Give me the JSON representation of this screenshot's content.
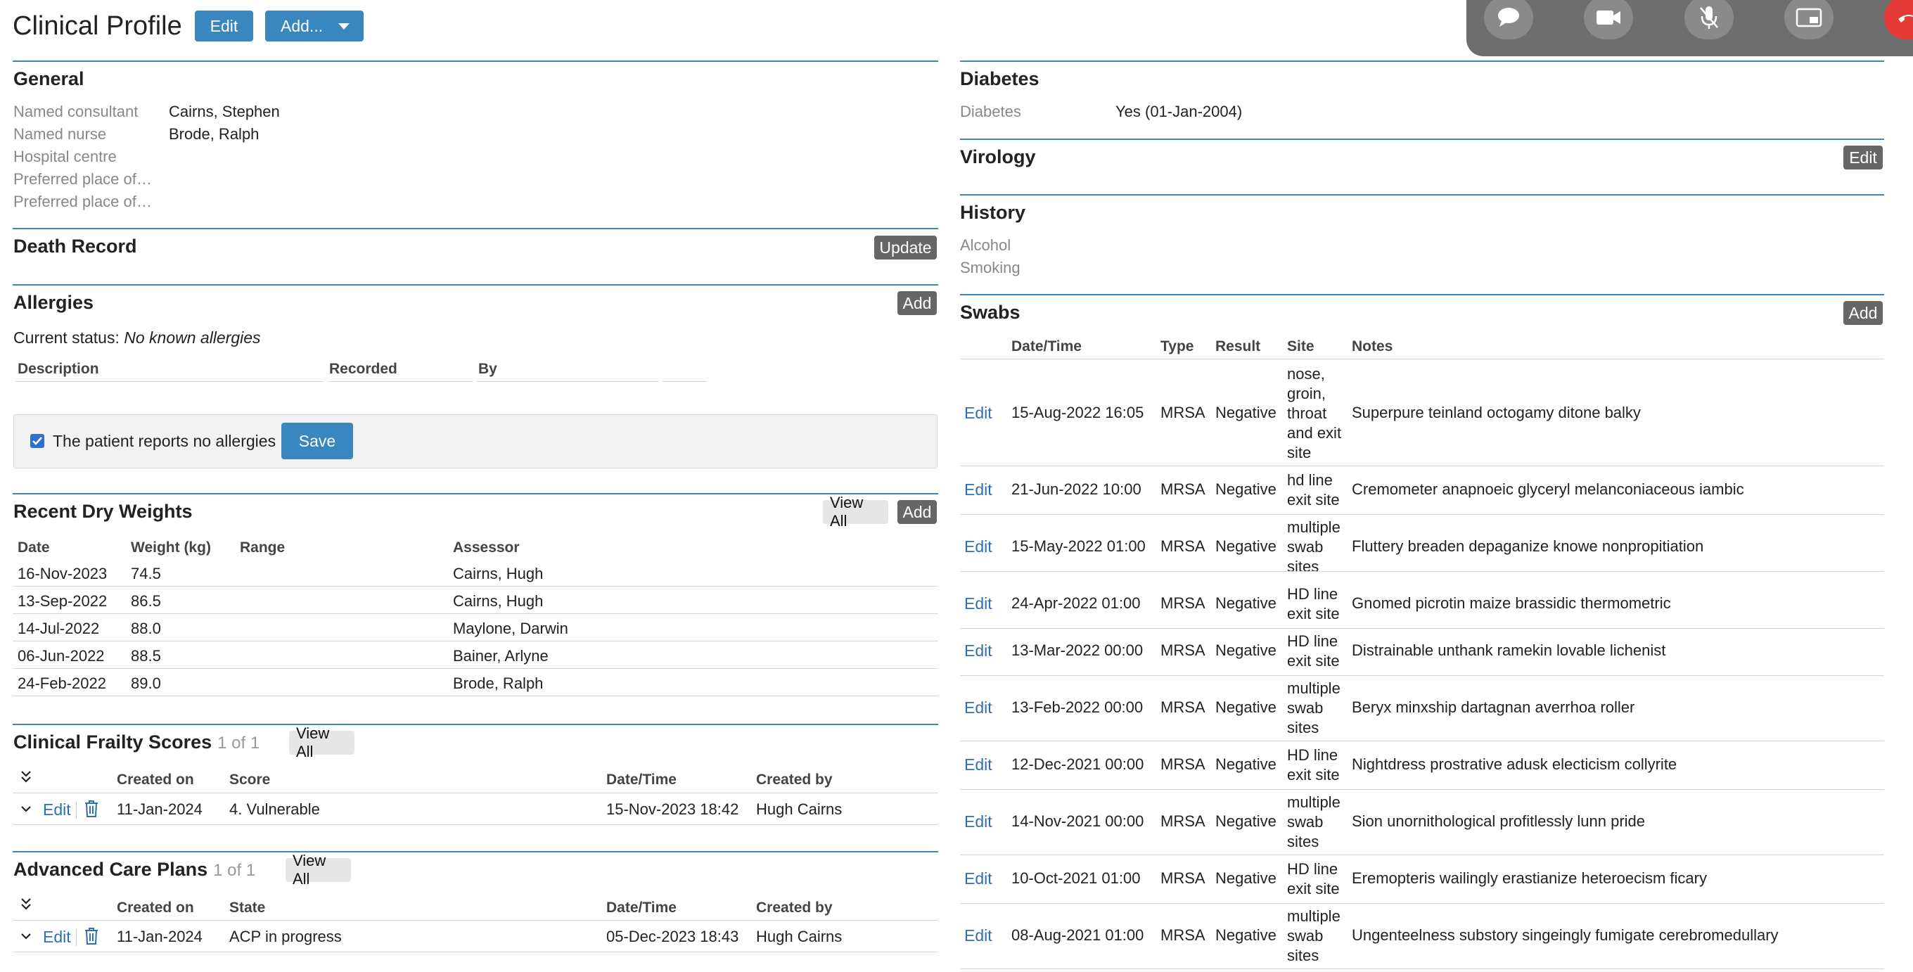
{
  "header": {
    "title": "Clinical Profile",
    "edit_label": "Edit",
    "add_label": "Add..."
  },
  "general": {
    "title": "General",
    "fields": [
      {
        "label": "Named consultant",
        "value": "Cairns, Stephen"
      },
      {
        "label": "Named nurse",
        "value": "Brode, Ralph"
      },
      {
        "label": "Hospital centre",
        "value": ""
      },
      {
        "label": "Preferred place of…",
        "value": ""
      },
      {
        "label": "Preferred place of…",
        "value": ""
      }
    ]
  },
  "death_record": {
    "title": "Death Record",
    "update_label": "Update"
  },
  "allergies": {
    "title": "Allergies",
    "add_label": "Add",
    "status_prefix": "Current status:",
    "status_value": "No known allergies",
    "columns": [
      "Description",
      "Recorded",
      "By"
    ],
    "checkbox_label": "The patient reports no allergies",
    "save_label": "Save"
  },
  "dry_weights": {
    "title": "Recent Dry Weights",
    "view_all_label": "View All",
    "add_label": "Add",
    "columns": [
      "Date",
      "Weight (kg)",
      "Range",
      "Assessor"
    ],
    "rows": [
      {
        "date": "16-Nov-2023",
        "weight": "74.5",
        "range": "",
        "assessor": "Cairns, Hugh"
      },
      {
        "date": "13-Sep-2022",
        "weight": "86.5",
        "range": "",
        "assessor": "Cairns, Hugh"
      },
      {
        "date": "14-Jul-2022",
        "weight": "88.0",
        "range": "",
        "assessor": "Maylone, Darwin"
      },
      {
        "date": "06-Jun-2022",
        "weight": "88.5",
        "range": "",
        "assessor": "Bainer, Arlyne"
      },
      {
        "date": "24-Feb-2022",
        "weight": "89.0",
        "range": "",
        "assessor": "Brode, Ralph"
      }
    ]
  },
  "frailty": {
    "title": "Clinical Frailty Scores",
    "count": "1 of 1",
    "view_all_label": "View All",
    "columns": [
      "Created on",
      "Score",
      "Date/Time",
      "Created by"
    ],
    "rows": [
      {
        "edit": "Edit",
        "created_on": "11-Jan-2024",
        "score": "4. Vulnerable",
        "datetime": "15-Nov-2023 18:42",
        "created_by": "Hugh Cairns"
      }
    ]
  },
  "acp": {
    "title": "Advanced Care Plans",
    "count": "1 of 1",
    "view_all_label": "View All",
    "columns": [
      "Created on",
      "State",
      "Date/Time",
      "Created by"
    ],
    "rows": [
      {
        "edit": "Edit",
        "created_on": "11-Jan-2024",
        "state": "ACP in progress",
        "datetime": "05-Dec-2023 18:43",
        "created_by": "Hugh Cairns"
      }
    ]
  },
  "diabetes": {
    "title": "Diabetes",
    "label": "Diabetes",
    "value": "Yes (01-Jan-2004)"
  },
  "virology": {
    "title": "Virology",
    "edit_label": "Edit"
  },
  "history": {
    "title": "History",
    "fields": [
      "Alcohol",
      "Smoking"
    ]
  },
  "swabs": {
    "title": "Swabs",
    "add_label": "Add",
    "columns": [
      "Date/Time",
      "Type",
      "Result",
      "Site",
      "Notes"
    ],
    "rows": [
      {
        "edit": "Edit",
        "datetime": "15-Aug-2022 16:05",
        "type": "MRSA",
        "result": "Negative",
        "site": "nose, groin, throat and exit site",
        "notes": "Superpure teinland octogamy ditone balky"
      },
      {
        "edit": "Edit",
        "datetime": "21-Jun-2022 10:00",
        "type": "MRSA",
        "result": "Negative",
        "site": "hd line exit site",
        "notes": "Cremometer anapnoeic glyceryl melanconiaceous iambic"
      },
      {
        "edit": "Edit",
        "datetime": "15-May-2022 01:00",
        "type": "MRSA",
        "result": "Negative",
        "site": "multiple swab sites",
        "notes": "Fluttery breaden depaganize knowe nonpropitiation"
      },
      {
        "edit": "Edit",
        "datetime": "24-Apr-2022 01:00",
        "type": "MRSA",
        "result": "Negative",
        "site": "HD line exit site",
        "notes": "Gnomed picrotin maize brassidic thermometric"
      },
      {
        "edit": "Edit",
        "datetime": "13-Mar-2022 00:00",
        "type": "MRSA",
        "result": "Negative",
        "site": "HD line exit site",
        "notes": "Distrainable unthank ramekin lovable lichenist"
      },
      {
        "edit": "Edit",
        "datetime": "13-Feb-2022 00:00",
        "type": "MRSA",
        "result": "Negative",
        "site": "multiple swab sites",
        "notes": "Beryx minxship dartagnan averrhoa roller"
      },
      {
        "edit": "Edit",
        "datetime": "12-Dec-2021 00:00",
        "type": "MRSA",
        "result": "Negative",
        "site": "HD line exit site",
        "notes": "Nightdress prostrative adusk electicism collyrite"
      },
      {
        "edit": "Edit",
        "datetime": "14-Nov-2021 00:00",
        "type": "MRSA",
        "result": "Negative",
        "site": "multiple swab sites",
        "notes": "Sion unornithological profitlessly lunn pride"
      },
      {
        "edit": "Edit",
        "datetime": "10-Oct-2021 01:00",
        "type": "MRSA",
        "result": "Negative",
        "site": "HD line exit site",
        "notes": "Eremopteris wailingly erastianize heteroecism ficary"
      },
      {
        "edit": "Edit",
        "datetime": "08-Aug-2021 01:00",
        "type": "MRSA",
        "result": "Negative",
        "site": "multiple swab sites",
        "notes": "Ungenteelness substory singeingly fumigate cerebromedullary"
      }
    ]
  },
  "call_controls": {
    "buttons": [
      "chat-icon",
      "video-camera-icon",
      "mute-microphone-icon",
      "share-screen-icon",
      "end-call-icon"
    ]
  },
  "colors": {
    "accent": "#3a87c0",
    "section_rule": "#3f86b8",
    "dark_button": "#666666",
    "end_call": "#e53935"
  }
}
